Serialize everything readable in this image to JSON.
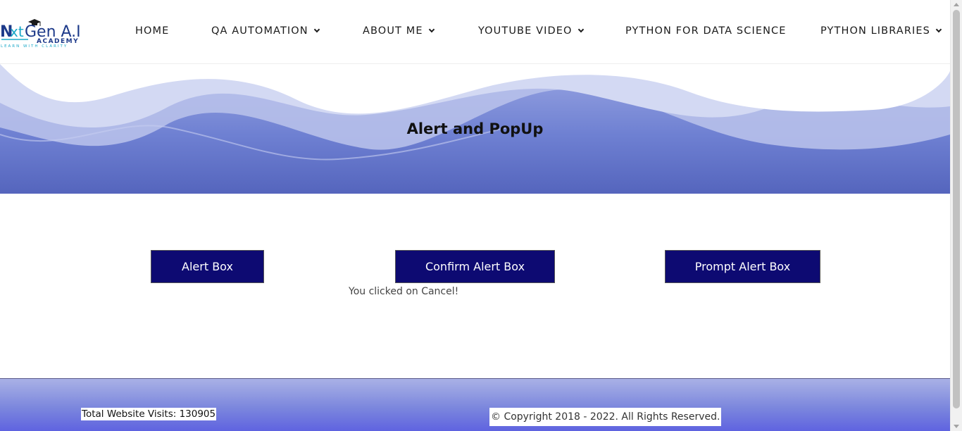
{
  "brand": {
    "logo_main": "NxtGen A.I",
    "logo_sub": "ACADEMY",
    "logo_tagline": "LEARN WITH CLARITY"
  },
  "nav": {
    "home": "HOME",
    "qa_automation": "QA AUTOMATION",
    "about_me": "ABOUT ME",
    "youtube_video": "YOUTUBE VIDEO",
    "python_ds": "PYTHON FOR DATA SCIENCE",
    "python_libraries": "PYTHON LIBRARIES"
  },
  "hero": {
    "title": "Alert and PopUp"
  },
  "buttons": {
    "alert": "Alert Box",
    "confirm": "Confirm Alert Box",
    "prompt": "Prompt Alert Box"
  },
  "result": {
    "text": "You clicked on Cancel!"
  },
  "footer": {
    "visits": "Total Website Visits: 130905",
    "copyright": "© Copyright 2018 - 2022. All Rights Reserved."
  },
  "colors": {
    "button_bg": "#0d0a72",
    "hero_blue": "#6e80d2",
    "logo_blue": "#1d3a8a",
    "logo_teal": "#1aa8c8"
  }
}
